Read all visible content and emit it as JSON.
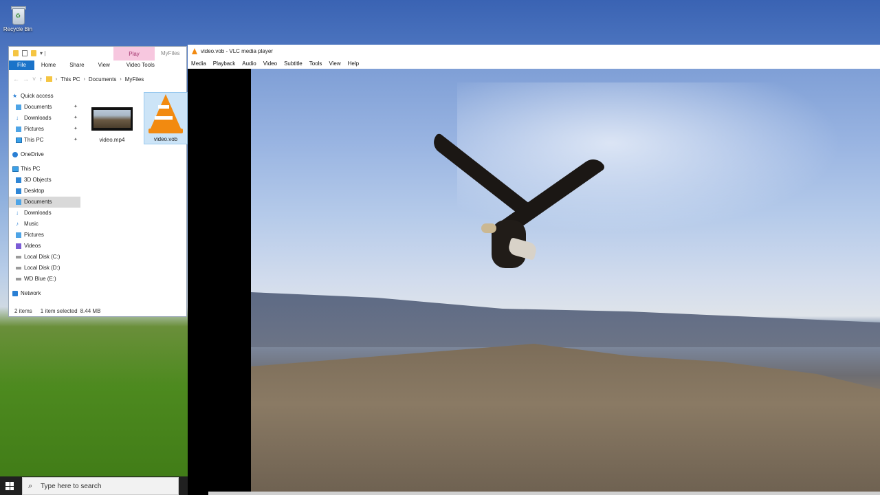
{
  "desktop": {
    "recycle_bin_label": "Recycle Bin"
  },
  "explorer": {
    "contextual_tab": "Play",
    "title": "MyFiles",
    "tabs": [
      "File",
      "Home",
      "Share",
      "View",
      "Video Tools"
    ],
    "breadcrumb": [
      "This PC",
      "Documents",
      "MyFiles"
    ],
    "nav": {
      "quick_access": "Quick access",
      "qa_items": [
        "Documents",
        "Downloads",
        "Pictures",
        "This PC"
      ],
      "onedrive": "OneDrive",
      "this_pc": "This PC",
      "pc_items": [
        "3D Objects",
        "Desktop",
        "Documents",
        "Downloads",
        "Music",
        "Pictures",
        "Videos",
        "Local Disk (C:)",
        "Local Disk (D:)",
        "WD Blue (E:)"
      ],
      "network": "Network"
    },
    "files": [
      {
        "name": "video.mp4",
        "type": "video-thumbnail"
      },
      {
        "name": "video.vob",
        "type": "vlc-icon",
        "selected": true
      }
    ],
    "status": {
      "items": "2 items",
      "selection": "1 item selected",
      "size": "8.44 MB"
    }
  },
  "vlc": {
    "title": "video.vob - VLC media player",
    "menu": [
      "Media",
      "Playback",
      "Audio",
      "Video",
      "Subtitle",
      "Tools",
      "View",
      "Help"
    ]
  },
  "taskbar": {
    "search_placeholder": "Type here to search"
  }
}
